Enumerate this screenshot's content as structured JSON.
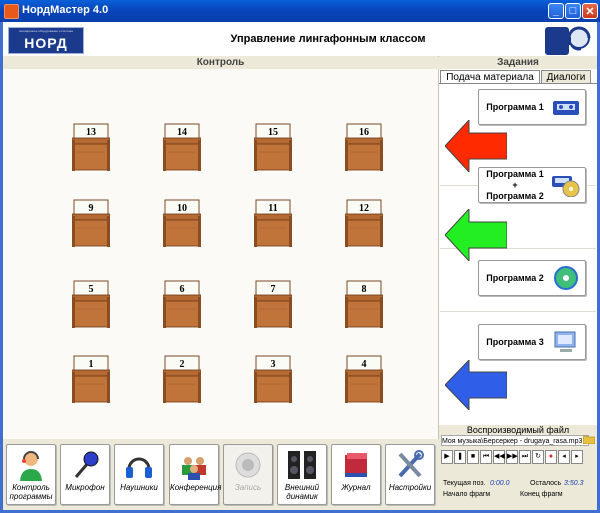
{
  "window": {
    "title": "НордМастер 4.0"
  },
  "header": {
    "logo_small": "лингафонное оборудование и системы",
    "logo_text": "НОРД",
    "title": "Управление лингафонным классом"
  },
  "control": {
    "heading": "Контроль",
    "desks": [
      "13",
      "14",
      "15",
      "16",
      "9",
      "10",
      "11",
      "12",
      "5",
      "6",
      "7",
      "8",
      "1",
      "2",
      "3",
      "4"
    ]
  },
  "tasks": {
    "heading": "Задания",
    "tabs": [
      "Подача материала",
      "Диалоги"
    ],
    "programs": [
      {
        "label": "Программа 1"
      },
      {
        "label": "Программа 1 + Программа 2",
        "line1": "Программа 1",
        "line2": "+",
        "line3": "Программа 2"
      },
      {
        "label": "Программа 2"
      },
      {
        "label": "Программа 3"
      }
    ],
    "arrow_colors": [
      "#ff2a00",
      "#22ee22",
      "#2f5fe8"
    ]
  },
  "player": {
    "label": "Воспроизводимый файл",
    "file": "Моя музыка\\Берсеркер - drugaya_rasa.mp3",
    "current_pos_label": "Текущая поз.",
    "current_pos": "0:00.0",
    "remaining_label": "Осталось",
    "remaining": "3:50.3",
    "frag_start": "Начало фрагм",
    "frag_end": "Конец фрагм"
  },
  "toolbar": [
    {
      "label1": "Контроль",
      "label2": "программы",
      "icon": "operator-icon"
    },
    {
      "label1": "Микрофон",
      "label2": "",
      "icon": "microphone-icon"
    },
    {
      "label1": "Наушники",
      "label2": "",
      "icon": "headphones-icon"
    },
    {
      "label1": "Конференция",
      "label2": "",
      "icon": "conference-icon"
    },
    {
      "label1": "Запись",
      "label2": "",
      "icon": "record-icon",
      "disabled": true
    },
    {
      "label1": "Внешний",
      "label2": "динамик",
      "icon": "speaker-icon"
    },
    {
      "label1": "Журнал",
      "label2": "",
      "icon": "journal-icon"
    },
    {
      "label1": "Настройки",
      "label2": "",
      "icon": "settings-icon"
    }
  ]
}
